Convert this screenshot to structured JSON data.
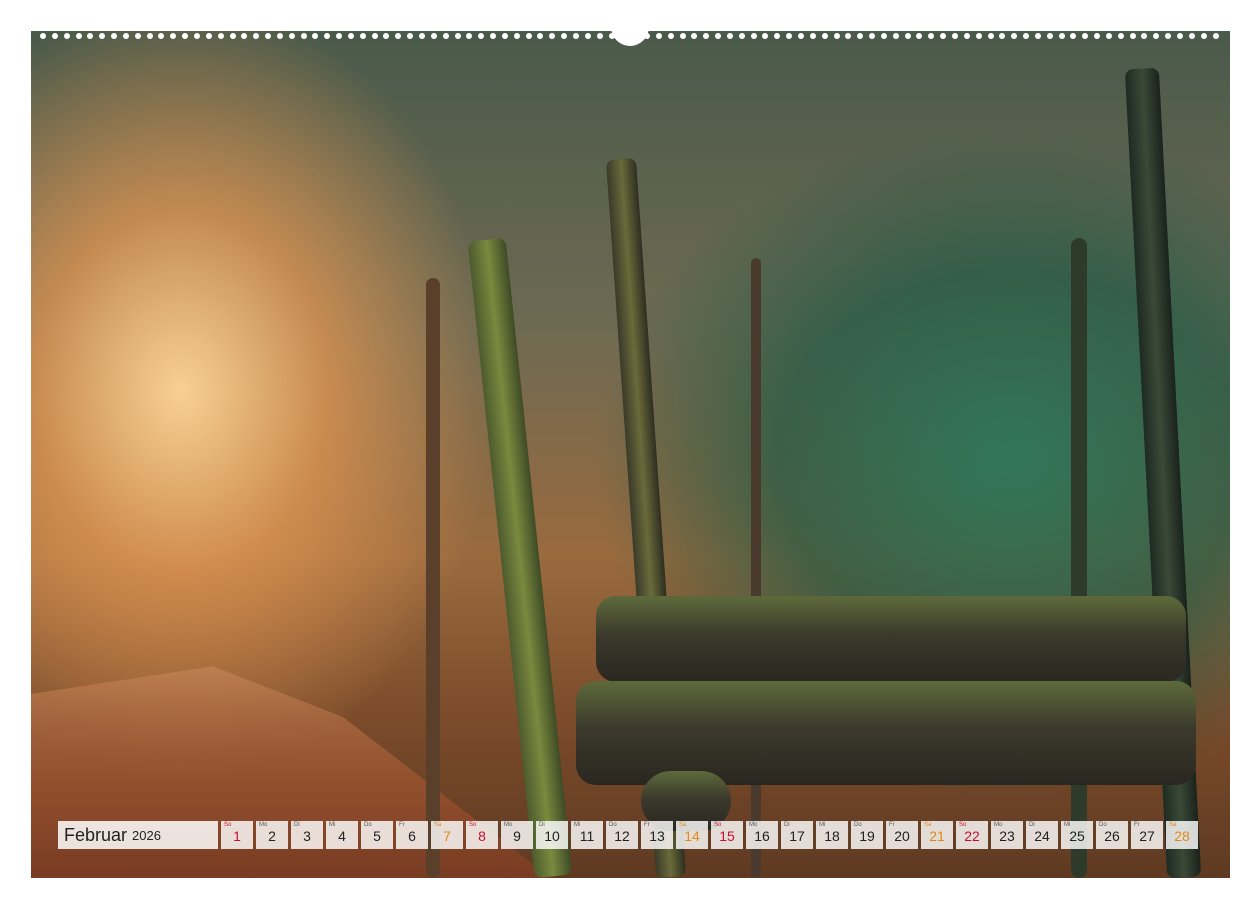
{
  "calendar": {
    "month": "Februar",
    "year": "2026",
    "days": [
      {
        "wd": "So",
        "num": "1",
        "type": "sun"
      },
      {
        "wd": "Mo",
        "num": "2",
        "type": ""
      },
      {
        "wd": "Di",
        "num": "3",
        "type": ""
      },
      {
        "wd": "Mi",
        "num": "4",
        "type": ""
      },
      {
        "wd": "Do",
        "num": "5",
        "type": ""
      },
      {
        "wd": "Fr",
        "num": "6",
        "type": ""
      },
      {
        "wd": "Sa",
        "num": "7",
        "type": "sat"
      },
      {
        "wd": "So",
        "num": "8",
        "type": "sun"
      },
      {
        "wd": "Mo",
        "num": "9",
        "type": ""
      },
      {
        "wd": "Di",
        "num": "10",
        "type": ""
      },
      {
        "wd": "Mi",
        "num": "11",
        "type": ""
      },
      {
        "wd": "Do",
        "num": "12",
        "type": ""
      },
      {
        "wd": "Fr",
        "num": "13",
        "type": ""
      },
      {
        "wd": "Sa",
        "num": "14",
        "type": "sat"
      },
      {
        "wd": "So",
        "num": "15",
        "type": "sun"
      },
      {
        "wd": "Mo",
        "num": "16",
        "type": ""
      },
      {
        "wd": "Di",
        "num": "17",
        "type": ""
      },
      {
        "wd": "Mi",
        "num": "18",
        "type": ""
      },
      {
        "wd": "Do",
        "num": "19",
        "type": ""
      },
      {
        "wd": "Fr",
        "num": "20",
        "type": ""
      },
      {
        "wd": "Sa",
        "num": "21",
        "type": "sat"
      },
      {
        "wd": "So",
        "num": "22",
        "type": "sun"
      },
      {
        "wd": "Mo",
        "num": "23",
        "type": ""
      },
      {
        "wd": "Di",
        "num": "24",
        "type": ""
      },
      {
        "wd": "Mi",
        "num": "25",
        "type": ""
      },
      {
        "wd": "Do",
        "num": "26",
        "type": ""
      },
      {
        "wd": "Fr",
        "num": "27",
        "type": ""
      },
      {
        "wd": "Sa",
        "num": "28",
        "type": "sat"
      }
    ]
  },
  "colors": {
    "sunday": "#c8102e",
    "saturday": "#e08a1e",
    "text": "#222222"
  }
}
